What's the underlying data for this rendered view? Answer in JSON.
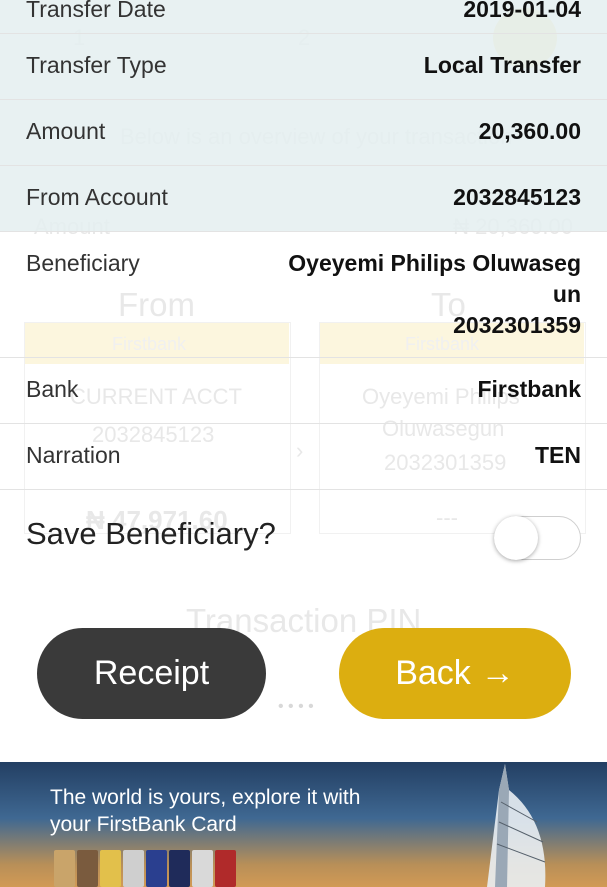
{
  "underlay": {
    "top_partial_label": "Transfer Date",
    "top_partial_value": "2019-01-04",
    "step_one": "1",
    "step_two": "2",
    "overview_text": "Below is an overview of your transaction",
    "amount_label": "Amount",
    "amount_value": "₦ 20,360.00",
    "from_label": "From",
    "to_label": "To",
    "from_bank": "Firstbank",
    "to_bank": "Firstbank",
    "from_account_type": "CURRENT ACCT",
    "from_account_no": "2032845123",
    "to_name_line1": "Oyeyemi Philips",
    "to_name_line2": "Oluwasegun",
    "to_account_no": "2032301359",
    "from_balance": "₦ 47,971.60",
    "to_balance": "---",
    "pin_label": "Transaction PIN",
    "pin_mask": "• • • •"
  },
  "details": {
    "transfer_type_label": "Transfer Type",
    "transfer_type_value": "Local Transfer",
    "amount_label": "Amount",
    "amount_value": "20,360.00",
    "from_account_label": "From Account",
    "from_account_value": "2032845123",
    "beneficiary_label": "Beneficiary",
    "beneficiary_name_line1": "Oyeyemi Philips Oluwaseg",
    "beneficiary_name_line2": "un",
    "beneficiary_account": "2032301359",
    "bank_label": "Bank",
    "bank_value": "Firstbank",
    "narration_label": "Narration",
    "narration_value": "TEN"
  },
  "save_beneficiary": {
    "label": "Save Beneficiary?",
    "enabled": false
  },
  "buttons": {
    "receipt_label": "Receipt",
    "back_label": "Back",
    "back_arrow": "→"
  },
  "banner": {
    "line1": "The world is yours, explore it with",
    "line2": "your FirstBank Card"
  },
  "colors": {
    "accent": "#dcae10",
    "dark_button": "#3a3a3a"
  }
}
